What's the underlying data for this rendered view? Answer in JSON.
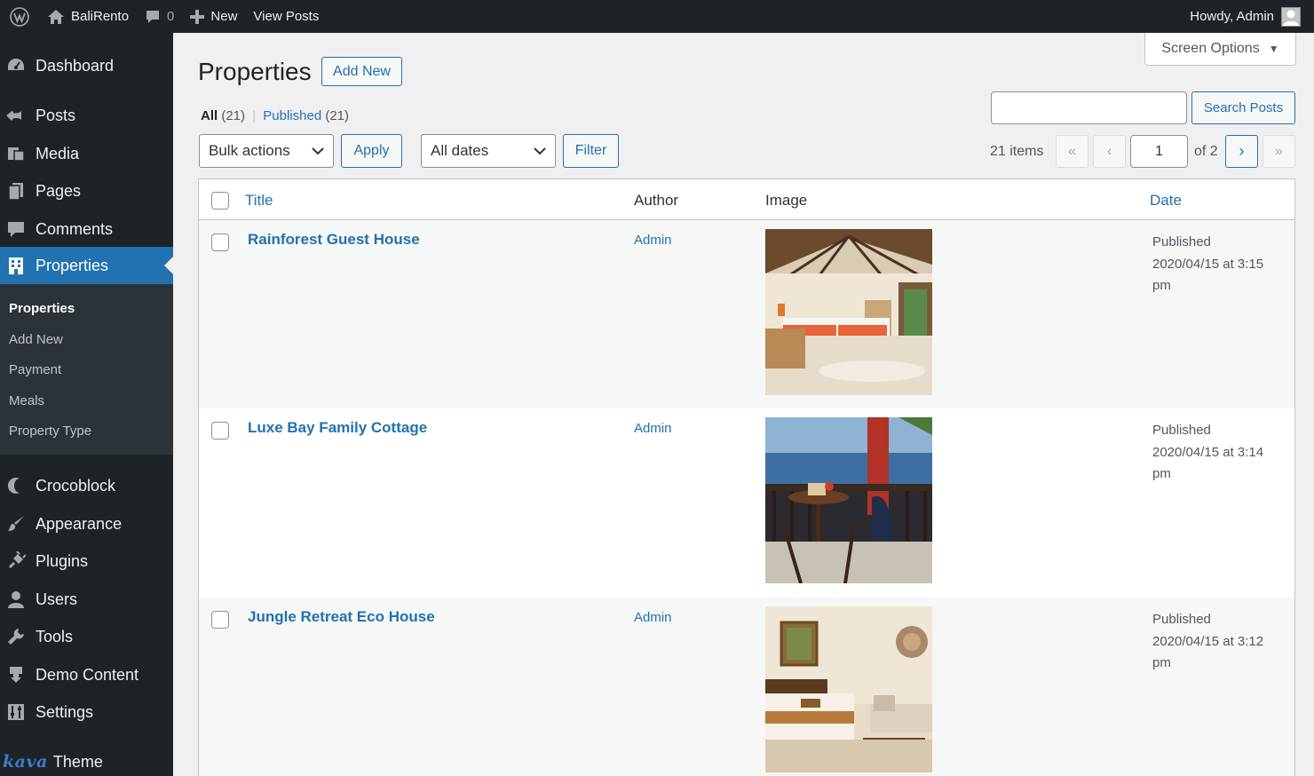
{
  "adminbar": {
    "site_name": "BaliRento",
    "comments_count": "0",
    "new_label": "New",
    "view_posts_label": "View Posts",
    "howdy": "Howdy, Admin"
  },
  "sidebar": {
    "items": [
      {
        "label": "Dashboard",
        "icon": "dashboard-icon"
      },
      {
        "label": "Posts",
        "icon": "pin-icon"
      },
      {
        "label": "Media",
        "icon": "media-icon"
      },
      {
        "label": "Pages",
        "icon": "pages-icon"
      },
      {
        "label": "Comments",
        "icon": "comment-icon"
      },
      {
        "label": "Properties",
        "icon": "building-icon"
      },
      {
        "label": "Crocoblock",
        "icon": "crocoblock-icon"
      },
      {
        "label": "Appearance",
        "icon": "brush-icon"
      },
      {
        "label": "Plugins",
        "icon": "plug-icon"
      },
      {
        "label": "Users",
        "icon": "user-icon"
      },
      {
        "label": "Tools",
        "icon": "wrench-icon"
      },
      {
        "label": "Demo Content",
        "icon": "download-icon"
      },
      {
        "label": "Settings",
        "icon": "sliders-icon"
      },
      {
        "label": "Theme",
        "icon": "kava-logo"
      }
    ],
    "submenu": [
      "Properties",
      "Add New",
      "Payment",
      "Meals",
      "Property Type"
    ],
    "kava_text": "kava"
  },
  "main": {
    "screen_options": "Screen Options",
    "title": "Properties",
    "add_new": "Add New",
    "filters": {
      "all_label": "All",
      "all_count": "(21)",
      "separator": "|",
      "published_label": "Published",
      "published_count": "(21)"
    },
    "search": {
      "value": "",
      "button": "Search Posts"
    },
    "bulk_actions": "Bulk actions",
    "apply": "Apply",
    "all_dates": "All dates",
    "filter": "Filter",
    "pagination": {
      "items": "21 items",
      "first": "«",
      "prev": "‹",
      "current": "1",
      "of": "of 2",
      "next": "›",
      "last": "»"
    },
    "table": {
      "columns": [
        "Title",
        "Author",
        "Image",
        "Date"
      ],
      "rows": [
        {
          "title": "Rainforest Guest House",
          "author": "Admin",
          "status": "Published",
          "date": "2020/04/15 at 3:15",
          "suffix": "pm",
          "image": "bedroom-photo"
        },
        {
          "title": "Luxe Bay Family Cottage",
          "author": "Admin",
          "status": "Published",
          "date": "2020/04/15 at 3:14",
          "suffix": "pm",
          "image": "terrace-photo"
        },
        {
          "title": "Jungle Retreat Eco House",
          "author": "Admin",
          "status": "Published",
          "date": "2020/04/15 at 3:12",
          "suffix": "pm",
          "image": "suite-photo"
        }
      ]
    }
  },
  "colors": {
    "adminbar_bg": "#1d2327",
    "accent": "#2271b1",
    "submenu_bg": "#2c3338",
    "page_bg": "#f0f0f1"
  }
}
